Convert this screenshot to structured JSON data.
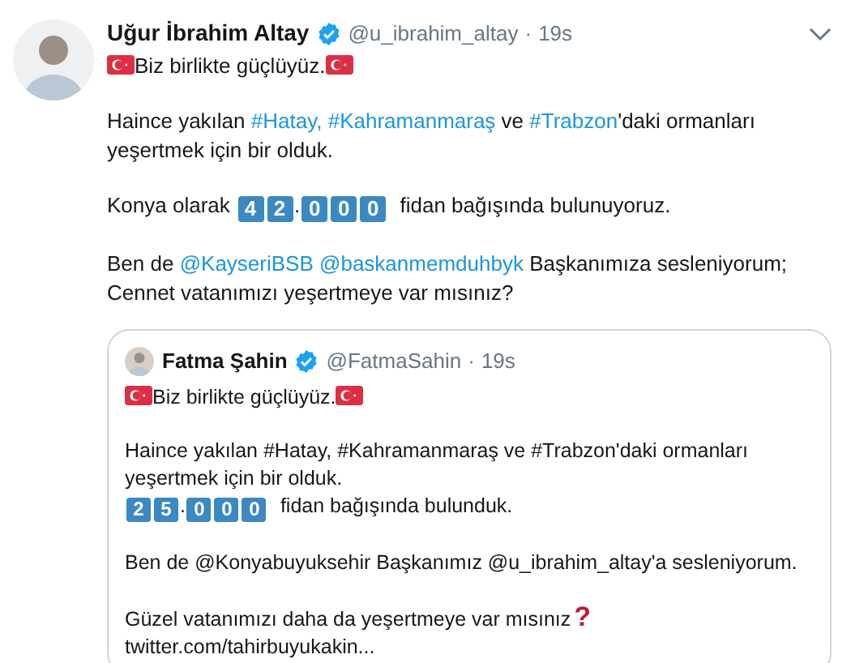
{
  "tweet": {
    "author": {
      "name": "Uğur İbrahim Altay",
      "verified": true,
      "handle": "@u_ibrahim_altay",
      "separator": "·",
      "time": "19s"
    },
    "paragraphs": [
      [
        [
          {
            "kind": "flag"
          },
          {
            "kind": "text",
            "text": "Biz birlikte güçlüyüz."
          },
          {
            "kind": "flag"
          }
        ]
      ],
      [
        [
          {
            "kind": "text",
            "text": "Haince yakılan "
          },
          {
            "kind": "link",
            "text": "#Hatay,"
          },
          {
            "kind": "link",
            "text": "#Kahramanmaraş"
          },
          {
            "kind": "text",
            "text": " ve "
          },
          {
            "kind": "link",
            "text": "#Trabzon"
          },
          {
            "kind": "text",
            "text": "'daki ormanları"
          }
        ],
        [
          {
            "kind": "text",
            "text": "yeşertmek için bir olduk."
          }
        ]
      ],
      [
        [
          {
            "kind": "text",
            "text": "Konya olarak "
          },
          {
            "kind": "keycap",
            "text": "4"
          },
          {
            "kind": "keycap",
            "text": "2"
          },
          {
            "kind": "dot",
            "text": "."
          },
          {
            "kind": "keycap",
            "text": "0"
          },
          {
            "kind": "keycap",
            "text": "0"
          },
          {
            "kind": "keycap",
            "text": "0"
          },
          {
            "kind": "text",
            "text": " fidan bağışında bulunuyoruz."
          }
        ]
      ],
      [
        [
          {
            "kind": "text",
            "text": "Ben de "
          },
          {
            "kind": "link",
            "text": "@KayseriBSB"
          },
          {
            "kind": "link",
            "text": "@baskanmemduhbyk"
          },
          {
            "kind": "text",
            "text": " Başkanımıza sesleniyorum;"
          }
        ],
        [
          {
            "kind": "text",
            "text": "Cennet vatanımızı yeşertmeye var mısınız?"
          }
        ]
      ]
    ],
    "quote": {
      "author": {
        "name": "Fatma Şahin",
        "verified": true,
        "handle": "@FatmaSahin",
        "separator": "·",
        "time": "19s"
      },
      "paragraphs": [
        [
          [
            {
              "kind": "flag"
            },
            {
              "kind": "text",
              "text": "Biz birlikte güçlüyüz."
            },
            {
              "kind": "flag"
            }
          ]
        ],
        [
          [
            {
              "kind": "text",
              "text": "Haince yakılan #Hatay, #Kahramanmaraş ve #Trabzon'daki ormanları"
            }
          ],
          [
            {
              "kind": "text",
              "text": "yeşertmek için bir olduk."
            }
          ],
          [
            {
              "kind": "keycap",
              "text": "2"
            },
            {
              "kind": "keycap",
              "text": "5"
            },
            {
              "kind": "dot",
              "text": "."
            },
            {
              "kind": "keycap",
              "text": "0"
            },
            {
              "kind": "keycap",
              "text": "0"
            },
            {
              "kind": "keycap",
              "text": "0"
            },
            {
              "kind": "text",
              "text": " fidan bağışında bulunduk."
            }
          ]
        ],
        [
          [
            {
              "kind": "text",
              "text": "Ben de @Konyabuyuksehir Başkanımız @u_ibrahim_altay'a sesleniyorum."
            }
          ]
        ],
        [
          [
            {
              "kind": "text",
              "text": "Güzel vatanımızı daha da yeşertmeye var mısınız"
            },
            {
              "kind": "qmark",
              "text": "?"
            }
          ],
          [
            {
              "kind": "text",
              "text": "twitter.com/tahirbuyukakin..."
            }
          ]
        ]
      ]
    }
  }
}
